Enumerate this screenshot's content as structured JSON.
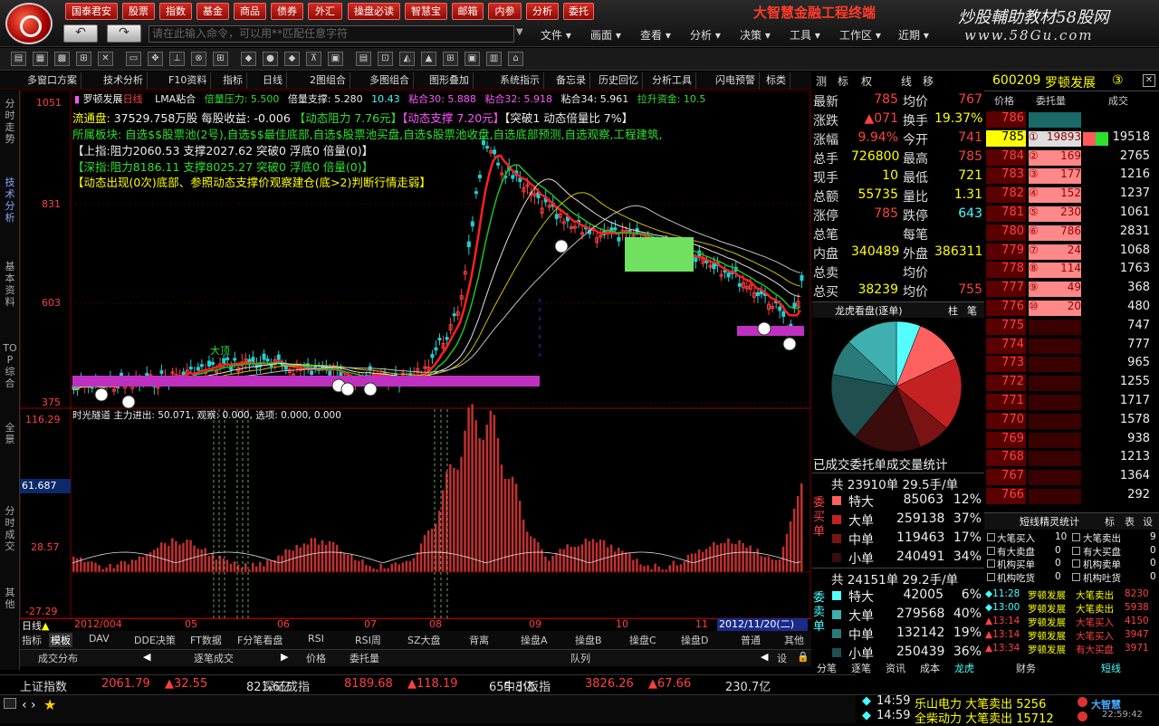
{
  "topbar": {
    "quick_buttons": [
      "国泰君安",
      "股票",
      "指数",
      "基金",
      "商品",
      "债券",
      "外汇",
      "操盘必读",
      "智慧宝",
      "邮箱",
      "内参",
      "分析",
      "委托"
    ],
    "brand": "大智慧金融工程终端",
    "watermark_top": "炒股輔助教材58股网",
    "watermark_bottom": "www.58Gu.com",
    "cmd_placeholder": "请在此输入命令，可以用**匹配任意字符",
    "menus": [
      "文件",
      "画面",
      "查看",
      "分析",
      "决策",
      "工具",
      "工作区",
      "近期"
    ]
  },
  "tabs": [
    "多窗口方案",
    "技术分析",
    "F10资料",
    "指标",
    "日线",
    "2图组合",
    "多图组合",
    "图形叠加",
    "系统指示",
    "备忘录",
    "历史回忆",
    "分析工具",
    "闪电预警",
    "标类"
  ],
  "left_tabs": [
    "分时走势",
    "技术分析",
    "基本资料",
    "TOP综合",
    "全景",
    "分时成交",
    "其他"
  ],
  "chart": {
    "stock_title": "罗顿发展",
    "period": "日线",
    "ma_label": "LMA粘合",
    "header_items": [
      "倍量压力: 5.500",
      "倍量支撑: 5.280",
      "10.43",
      "粘合30: 5.888",
      "粘合32: 5.918",
      "粘合34: 5.961",
      "拉升资金: 10.5"
    ],
    "ylabels": [
      "1051",
      "831",
      "603",
      "375"
    ],
    "info1": "流通盘: 37529.758万股 每股收益: -0.006 【动态阻力 7.76元】【动态支撑 7.20元】【突破1 动态倍量比 7%】",
    "info1_parts": {
      "a": "流通盘:",
      "b": "37529.758万股",
      "c": "每股收益:",
      "d": "-0.006",
      "e": "【动态阻力 7.76元】",
      "f": "【动态支撑 7.20元】",
      "g": "【突破1 动态倍量比 7%】"
    },
    "info2": "所属板块: 自选$$股票池(2号),自选$$最佳底部,自选$股票池买盘,自选$股票池收盘,自选底部预测,自选观察,工程建筑,",
    "info3": "【上指:阻力2060.53 支撑2027.62 突破0 浮底0 倍量(0)】",
    "info4": "【深指:阻力8186.11 支撑8025.27 突破0 浮底0 倍量(0)】",
    "info5": "【动态出现(0次)底部、参照动态支撑价观察建仓(底>2)判断行情走弱】",
    "sub_title": "时光隧道 主力进出: 50.071, 观察: 0.000, 选项: 0.000, 0.000",
    "sub_ylabels": [
      "116.29",
      "61.687",
      "28.57",
      "-27.29"
    ],
    "sub_current": "61.687",
    "date_labels": [
      "日线",
      "2012/004",
      "05",
      "06",
      "07",
      "08",
      "09",
      "10",
      "11"
    ],
    "date_current": "2012/11/20(二)",
    "annotation": "大顶"
  },
  "bottom_tabs": [
    "指标",
    "模板",
    "DAV",
    "DDE决策",
    "FT数据",
    "F分笔看盘",
    "RSI",
    "RSI周",
    "SZ大盘",
    "背离",
    "操盘A",
    "操盘B",
    "操盘C",
    "操盘D",
    "普通",
    "其他"
  ],
  "sub_tabs": [
    "成交分布",
    "逐笔成交",
    "价格",
    "委托量",
    "队列",
    "设"
  ],
  "ticker": [
    {
      "name": "上证指数",
      "v": "2061.79",
      "c": "▲32.55",
      "amt": "821.6亿"
    },
    {
      "name": "深证成指",
      "v": "8189.68",
      "c": "▲118.19",
      "amt": "655.3亿"
    },
    {
      "name": "中小板指",
      "v": "3826.26",
      "c": "▲67.66",
      "amt": "230.7亿"
    }
  ],
  "right": {
    "tabs": [
      "测",
      "标",
      "权",
      "线",
      "移"
    ],
    "code": "600209",
    "name": "罗顿发展",
    "suffix": "③",
    "quote": [
      [
        "最新",
        "785",
        "均价",
        "767"
      ],
      [
        "涨跌",
        "▲071",
        "换手",
        "19.37%"
      ],
      [
        "涨幅",
        "9.94%",
        "今开",
        "741"
      ],
      [
        "总手",
        "726800",
        "最高",
        "785"
      ],
      [
        "现手",
        "10",
        "最低",
        "721"
      ],
      [
        "总额",
        "55735",
        "量比",
        "1.31"
      ],
      [
        "涨停",
        "785",
        "跌停",
        "643"
      ],
      [
        "总笔",
        "",
        "每笔",
        ""
      ],
      [
        "内盘",
        "340489",
        "外盘",
        "386311"
      ],
      [
        "总卖",
        "",
        "均价",
        ""
      ],
      [
        "总买",
        "38239",
        "均价",
        "755"
      ]
    ],
    "ob_head": [
      "价格",
      "委托量",
      "成交"
    ],
    "orderbook": [
      [
        "786",
        "",
        "",
        ""
      ],
      [
        "785",
        "①",
        "19893",
        "19518"
      ],
      [
        "784",
        "②",
        "169",
        "2765"
      ],
      [
        "783",
        "③",
        "177",
        "1216"
      ],
      [
        "782",
        "④",
        "152",
        "1237"
      ],
      [
        "781",
        "⑤",
        "230",
        "1061"
      ],
      [
        "780",
        "⑥",
        "786",
        "2831"
      ],
      [
        "779",
        "⑦",
        "24",
        "1068"
      ],
      [
        "778",
        "⑧",
        "114",
        "1763"
      ],
      [
        "777",
        "⑨",
        "49",
        "368"
      ],
      [
        "776",
        "⑩",
        "20",
        "480"
      ],
      [
        "775",
        "",
        "",
        "747"
      ],
      [
        "774",
        "",
        "",
        "777"
      ],
      [
        "773",
        "",
        "",
        "965"
      ],
      [
        "772",
        "",
        "",
        "1255"
      ],
      [
        "771",
        "",
        "",
        "1717"
      ],
      [
        "770",
        "",
        "",
        "1578"
      ],
      [
        "769",
        "",
        "",
        "938"
      ],
      [
        "768",
        "",
        "",
        "1213"
      ],
      [
        "767",
        "",
        "",
        "1364"
      ],
      [
        "766",
        "",
        "",
        "292"
      ]
    ],
    "pie_title": "龙虎看盘(逐单)",
    "pie_side": [
      "柱",
      "笔"
    ],
    "pie_caption": "已成交委托单成交量统计",
    "buy_head": "共 23910单 29.5手/单",
    "buy_label": "委买单",
    "buy_rows": [
      [
        "特大",
        "85063",
        "12%"
      ],
      [
        "大单",
        "259138",
        "37%"
      ],
      [
        "中单",
        "119463",
        "17%"
      ],
      [
        "小单",
        "240491",
        "34%"
      ]
    ],
    "sell_head": "共 24151单 29.2手/单",
    "sell_label": "委卖单",
    "sell_rows": [
      [
        "特大",
        "42005",
        "6%"
      ],
      [
        "大单",
        "279568",
        "40%"
      ],
      [
        "中单",
        "132142",
        "19%"
      ],
      [
        "小单",
        "250439",
        "36%"
      ]
    ],
    "elf_title": "短线精灵统计",
    "elf_tabs": [
      "标",
      "表",
      "设"
    ],
    "elf_rows": [
      [
        "大笔买入",
        "10",
        "大笔卖出",
        "9"
      ],
      [
        "有大卖盘",
        "0",
        "有大买盘",
        "0"
      ],
      [
        "机构买单",
        "0",
        "机构卖单",
        "0"
      ],
      [
        "机构吃货",
        "0",
        "机构吐货",
        "0"
      ]
    ],
    "elf_events": [
      [
        "11:28",
        "罗顿发展",
        "大笔卖出",
        "8230"
      ],
      [
        "13:00",
        "罗顿发展",
        "大笔卖出",
        "5938"
      ],
      [
        "13:14",
        "罗顿发展",
        "大笔买入",
        "4150"
      ],
      [
        "13:14",
        "罗顿发展",
        "大笔买入",
        "3947"
      ],
      [
        "13:34",
        "罗顿发展",
        "有大买盘",
        "3971"
      ]
    ],
    "bottom_tabs": [
      "分笔",
      "逐笔",
      "资讯",
      "成本",
      "龙虎",
      "财务",
      "短线"
    ]
  },
  "news": [
    {
      "time": "14:59",
      "text": "乐山电力 大笔卖出 5256"
    },
    {
      "time": "14:59",
      "text": "全柴动力 大笔卖出 15712"
    }
  ],
  "clock": "22:59:42",
  "brand_small": "大智慧"
}
